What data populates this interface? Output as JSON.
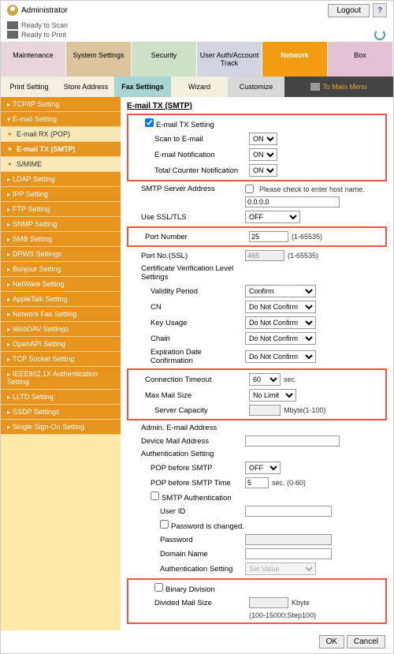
{
  "topbar": {
    "admin": "Administrator",
    "logout": "Logout",
    "help": "?"
  },
  "status": {
    "scan": "Ready to Scan",
    "print": "Ready to Print"
  },
  "mainTabs": {
    "maint": "Maintenance",
    "sys": "System Settings",
    "sec": "Security",
    "user": "User Auth/Account Track",
    "net": "Network",
    "box": "Box"
  },
  "subTabs": {
    "print": "Print Setting",
    "store": "Store Address",
    "fax": "Fax Settings",
    "wiz": "Wizard",
    "cust": "Customize",
    "menu": "To Main Menu"
  },
  "sidebar": {
    "tcpip": "TCP/IP Setting",
    "email": "E-mail Setting",
    "emailrx": "E-mail RX (POP)",
    "emailtx": "E-mail TX (SMTP)",
    "smime": "S/MIME",
    "ldap": "LDAP Setting",
    "ipp": "IPP Setting",
    "ftp": "FTP Setting",
    "snmp": "SNMP Setting",
    "smb": "SMB Setting",
    "dpws": "DPWS Settings",
    "bonj": "Bonjour Setting",
    "netware": "NetWare Setting",
    "apple": "AppleTalk Setting",
    "netfax": "Network Fax Setting",
    "webdav": "WebDAV Settings",
    "openapi": "OpenAPI Setting",
    "tcpsock": "TCP Socket Setting",
    "ieee": "IEEE802.1X Authentication Setting",
    "lltd": "LLTD Setting",
    "ssdp": "SSDP Settings",
    "sso": "Single Sign-On Setting"
  },
  "content": {
    "title": "E-mail TX (SMTP)",
    "emailTxSetting": "E-mail TX Setting",
    "scanEmail": "Scan to E-mail",
    "scanEmailV": "ON",
    "emailNotif": "E-mail Notification",
    "emailNotifV": "ON",
    "totalCounter": "Total Counter Notification",
    "totalCounterV": "ON",
    "smtpAddr": "SMTP Server Address",
    "smtpHostCheck": "Please check to enter host name.",
    "smtpHostV": "0.0.0.0",
    "useSSL": "Use SSL/TLS",
    "useSSLV": "OFF",
    "portNum": "Port Number",
    "portNumV": "25",
    "portRange": "(1-65535)",
    "portNumSSL": "Port No.(SSL)",
    "portNumSSLV": "465",
    "certLevel": "Certificate Verification Level Settings",
    "validity": "Validity Period",
    "validityV": "Confirm",
    "cn": "CN",
    "cnV": "Do Not Confirm",
    "keyUsage": "Key Usage",
    "keyUsageV": "Do Not Confirm",
    "chain": "Chain",
    "chainV": "Do Not Confirm",
    "expDate": "Expiration Date Confirmation",
    "expDateV": "Do Not Confirm",
    "connTimeout": "Connection Timeout",
    "connTimeoutV": "60",
    "secLbl": "sec.",
    "maxMail": "Max Mail Size",
    "maxMailV": "No Limit",
    "srvCap": "Server Capacity",
    "srvCapUnit": "Mbyte(1-100)",
    "adminEmail": "Admin. E-mail Address",
    "deviceEmail": "Device Mail Address",
    "authSetting": "Authentication Setting",
    "popBefore": "POP before SMTP",
    "popBeforeV": "OFF",
    "popTime": "POP before SMTP Time",
    "popTimeV": "5",
    "popTimeUnit": "sec. (0-60)",
    "smtpAuth": "SMTP Authentication",
    "userId": "User ID",
    "pwdChanged": "Password is changed.",
    "pwd": "Password",
    "domain": "Domain Name",
    "authSet": "Authentication Setting",
    "authSetV": "Set Value",
    "binDiv": "Binary Division",
    "divMail": "Divided Mail Size",
    "divMailUnit": "Kbyte",
    "divMailRange": "(100-15000;Step100)"
  },
  "footer": {
    "ok": "OK",
    "cancel": "Cancel"
  }
}
